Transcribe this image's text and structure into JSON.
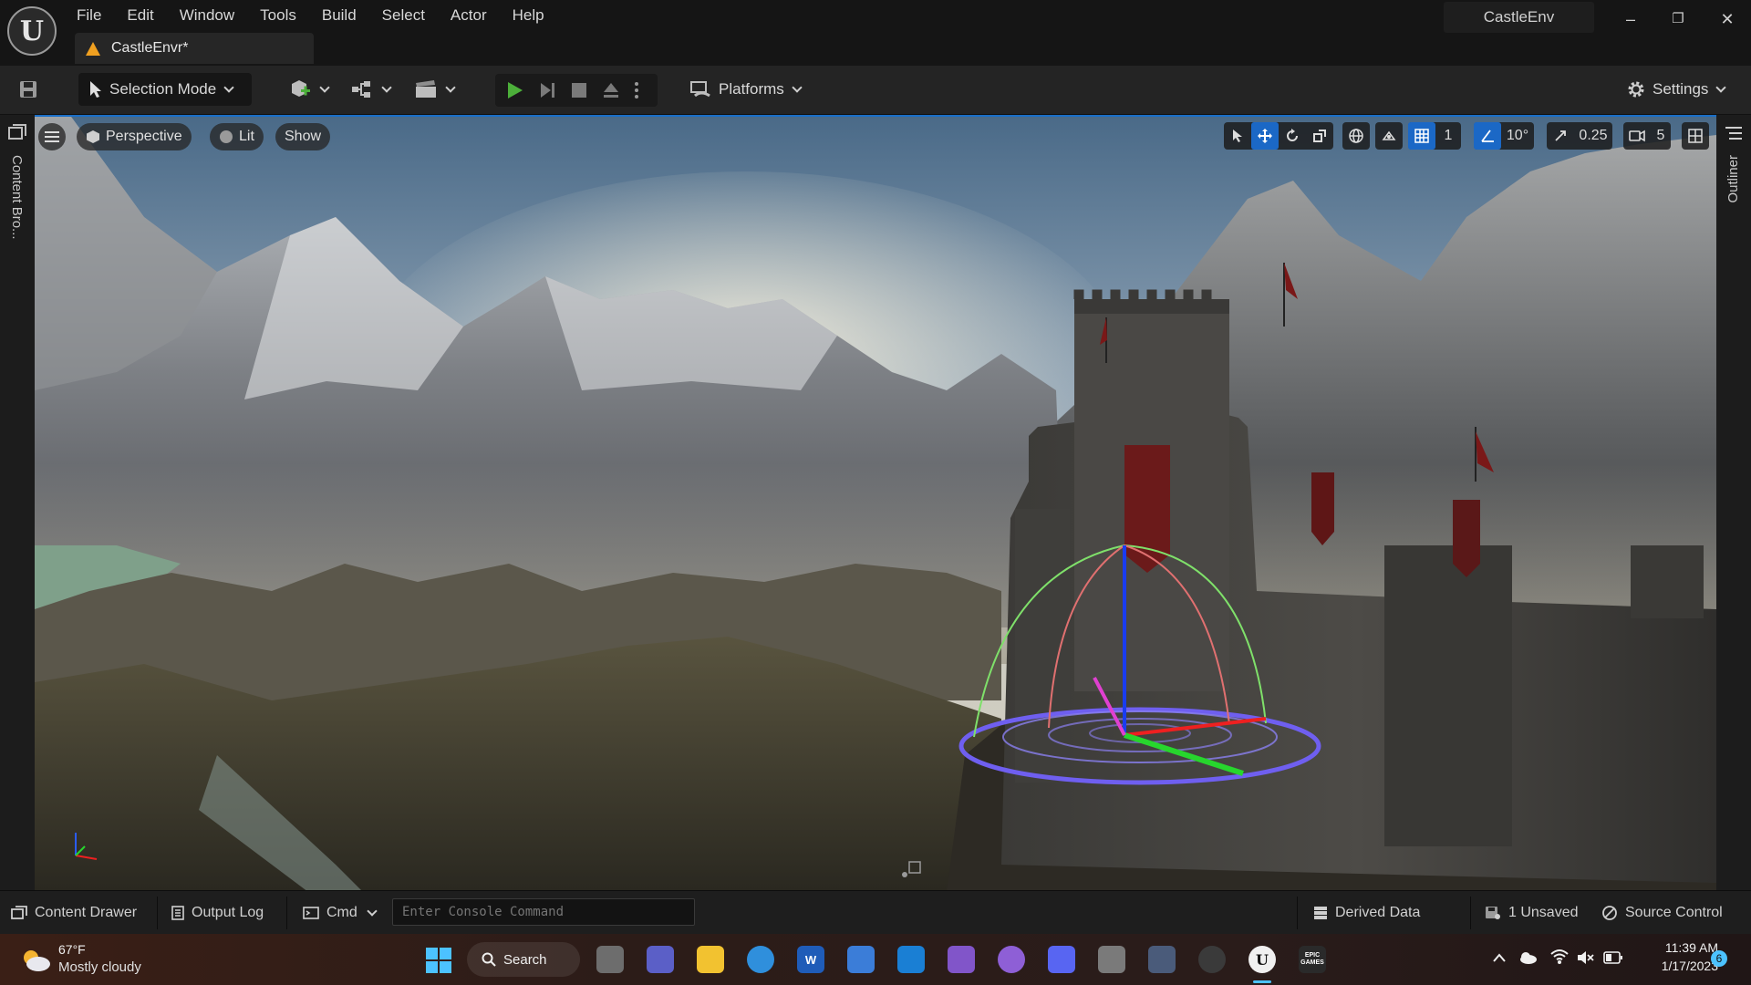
{
  "menu": [
    "File",
    "Edit",
    "Window",
    "Tools",
    "Build",
    "Select",
    "Actor",
    "Help"
  ],
  "doc_tab": {
    "label": "CastleEnvr*"
  },
  "project_name": "CastleEnv",
  "window_controls": {
    "minimize": "–",
    "restore": "❐",
    "close": "✕"
  },
  "toolbar": {
    "selection_mode": "Selection Mode",
    "platforms": "Platforms",
    "settings": "Settings"
  },
  "left_panel": {
    "label": "Content Bro..."
  },
  "right_panel": {
    "label": "Outliner"
  },
  "viewport": {
    "perspective": "Perspective",
    "lit": "Lit",
    "show": "Show",
    "grid_snap": "1",
    "rotation_snap": "10°",
    "scale_snap": "0.25",
    "camera_speed": "5"
  },
  "statusbar": {
    "content_drawer": "Content Drawer",
    "output_log": "Output Log",
    "cmd": "Cmd",
    "console_placeholder": "Enter Console Command",
    "derived_data": "Derived Data",
    "unsaved": "1 Unsaved",
    "source_control": "Source Control"
  },
  "taskbar": {
    "weather_temp": "67°F",
    "weather_desc": "Mostly cloudy",
    "search": "Search",
    "time": "11:39 AM",
    "date": "1/17/2023",
    "notifications": "6",
    "epic_label": "EPIC GAMES"
  },
  "colors": {
    "accent": "#1b68c6",
    "play_green": "#4caf3a",
    "warning": "#f0a020"
  }
}
